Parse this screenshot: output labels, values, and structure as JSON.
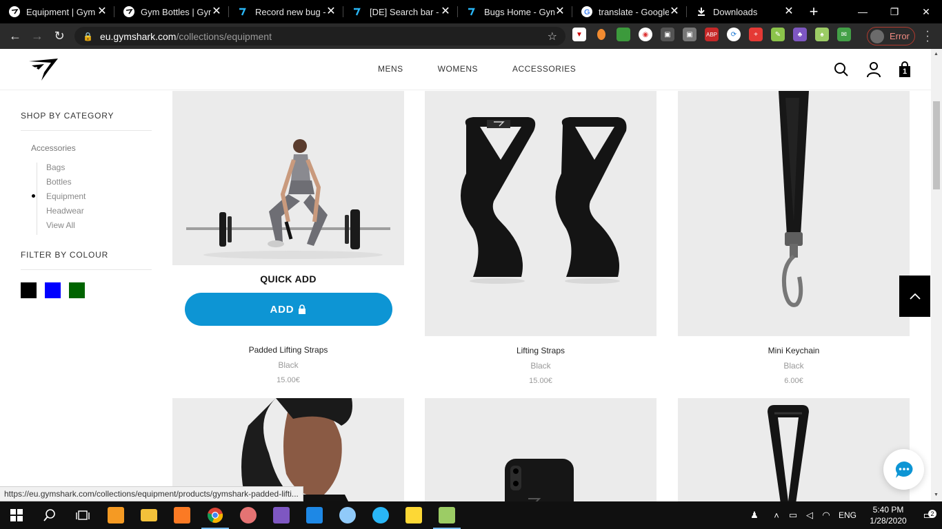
{
  "browser": {
    "tabs": [
      {
        "title": "Equipment | Gym",
        "favicon": "gymshark-icon",
        "active": true
      },
      {
        "title": "Gym Bottles | Gym",
        "favicon": "gymshark-icon",
        "active": false
      },
      {
        "title": "Record new bug -",
        "favicon": "bugtracker-icon",
        "active": false
      },
      {
        "title": "[DE] Search bar - N",
        "favicon": "bugtracker-icon",
        "active": false
      },
      {
        "title": "Bugs Home - Gym",
        "favicon": "bugtracker-icon",
        "active": false
      },
      {
        "title": "translate - Google",
        "favicon": "google-icon",
        "active": false
      },
      {
        "title": "Downloads",
        "favicon": "download-icon",
        "active": false
      }
    ],
    "url_host": "eu.gymshark.com",
    "url_path": "/collections/equipment",
    "profile_label": "Error",
    "status_url": "https://eu.gymshark.com/collections/equipment/products/gymshark-padded-lifti..."
  },
  "site": {
    "nav": [
      "MENS",
      "WOMENS",
      "ACCESSORIES"
    ],
    "cart_count": "1"
  },
  "sidebar": {
    "category_heading": "SHOP BY CATEGORY",
    "root": "Accessories",
    "items": [
      {
        "label": "Bags",
        "active": false
      },
      {
        "label": "Bottles",
        "active": false
      },
      {
        "label": "Equipment",
        "active": true
      },
      {
        "label": "Headwear",
        "active": false
      },
      {
        "label": "View All",
        "active": false
      }
    ],
    "colour_heading": "FILTER BY COLOUR",
    "colours": [
      "#000000",
      "#0000ff",
      "#006400"
    ]
  },
  "products": [
    {
      "name": "Padded Lifting Straps",
      "colour": "Black",
      "price": "15.00€"
    },
    {
      "name": "Lifting Straps",
      "colour": "Black",
      "price": "15.00€"
    },
    {
      "name": "Mini Keychain",
      "colour": "Black",
      "price": "6.00€"
    }
  ],
  "quick_add": {
    "label": "QUICK ADD",
    "button": "ADD",
    "accent": "#0d95d4"
  },
  "taskbar": {
    "language": "ENG",
    "time": "5:40 PM",
    "date": "1/28/2020",
    "notifications": "2"
  }
}
